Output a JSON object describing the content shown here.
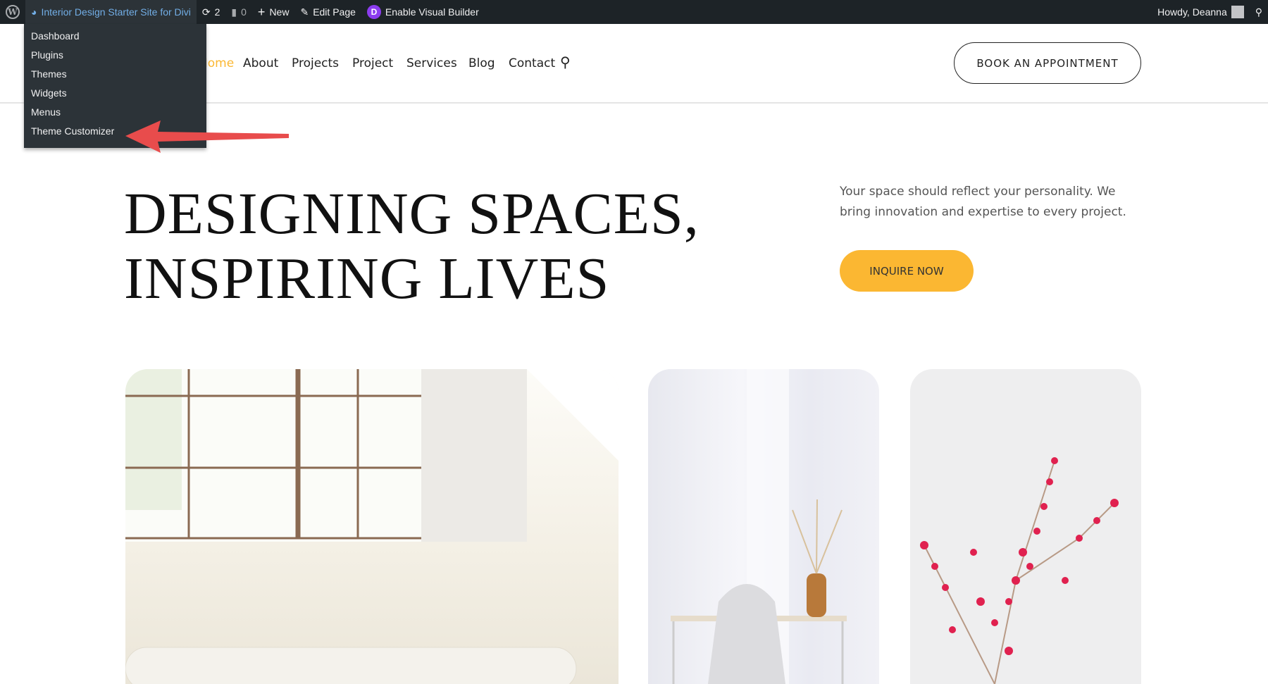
{
  "adminbar": {
    "site_name": "Interior Design Starter Site for Divi",
    "updates": "2",
    "comments": "0",
    "new": "New",
    "edit": "Edit Page",
    "visual_builder": "Enable Visual Builder",
    "howdy": "Howdy, Deanna",
    "divi_letter": "D"
  },
  "site_menu": [
    "Dashboard",
    "Plugins",
    "Themes",
    "Widgets",
    "Menus",
    "Theme Customizer"
  ],
  "nav": {
    "items": [
      "Home",
      "About",
      "Projects",
      "Project",
      "Services",
      "Blog",
      "Contact"
    ],
    "active_color": "#fbb732"
  },
  "header": {
    "book_label": "BOOK AN APPOINTMENT"
  },
  "hero": {
    "line1": "DESIGNING SPACES,",
    "line2": "INSPIRING LIVES",
    "paragraph": "Your space should reflect your personality. We bring innovation and expertise to every project.",
    "cta": "INQUIRE NOW"
  },
  "colors": {
    "accent": "#fbb732",
    "annotation_arrow": "#e84c4c",
    "adminbar": "#1d2327"
  }
}
